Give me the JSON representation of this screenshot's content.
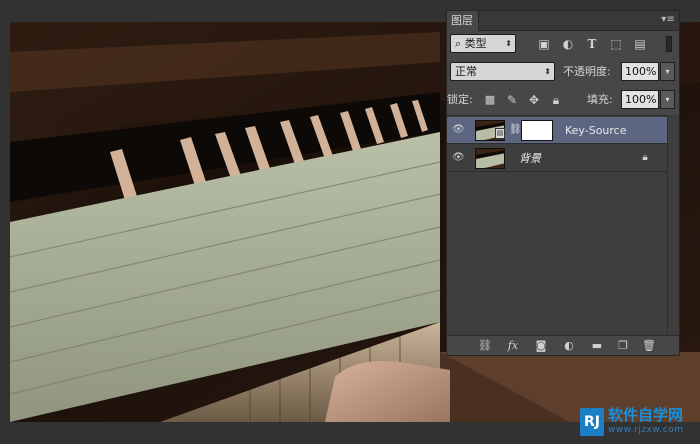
{
  "panel": {
    "title": "图层",
    "menu_icon": "panel-menu-icon",
    "filter": {
      "label": "类型",
      "icon": "search-icon"
    },
    "filter_icons": [
      "image-filter-icon",
      "adjustment-filter-icon",
      "type-filter-icon",
      "shape-filter-icon",
      "smart-object-filter-icon"
    ],
    "blend_mode": "正常",
    "opacity_label": "不透明度:",
    "opacity_value": "100%",
    "lock_label": "锁定:",
    "lock_icons": [
      "lock-transparent-icon",
      "lock-pixels-icon",
      "lock-position-icon",
      "lock-all-icon"
    ],
    "fill_label": "填充:",
    "fill_value": "100%"
  },
  "layers": [
    {
      "name": "Key-Source",
      "visible": true,
      "selected": true,
      "has_mask": true,
      "icons": [
        "eye-icon",
        "smart-object-icon",
        "link-icon"
      ]
    },
    {
      "name": "背景",
      "visible": true,
      "selected": false,
      "locked": true,
      "icons": [
        "eye-icon",
        "lock-icon"
      ]
    }
  ],
  "footer_icons": [
    "link-layers-icon",
    "fx-icon",
    "add-mask-icon",
    "new-adjustment-icon",
    "new-group-icon",
    "new-layer-icon",
    "delete-layer-icon"
  ],
  "footer_fx_label": "fx",
  "watermark": {
    "badge": "RJ",
    "text": "软件自学网",
    "url": "www.rjzxw.com"
  },
  "colors": {
    "selected_layer": "#5d6680",
    "panel_bg": "#474747",
    "watermark_blue": "#1b7fc6"
  }
}
